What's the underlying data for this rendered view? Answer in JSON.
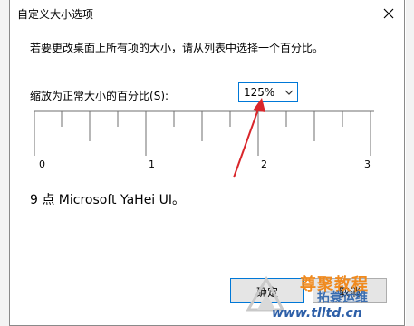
{
  "dialog": {
    "title": "自定义大小选项",
    "close_label": "×",
    "description": "若要更改桌面上所有项的大小，请从列表中选择一个百分比。",
    "scale_label_prefix": "缩放为正常大小的百分比(",
    "scale_label_key": "S",
    "scale_label_suffix": "):",
    "scale_value": "125%",
    "ruler_labels": [
      "0",
      "1",
      "2",
      "3"
    ],
    "font_info": "9 点 Microsoft YaHei UI。",
    "ok_label": "确定",
    "cancel_label": "取消"
  },
  "watermark": {
    "text_cn": "尊聚教程",
    "text_cn2": "拓蓑运维",
    "url": "www.tlltd.cn"
  },
  "colors": {
    "accent": "#0078d7",
    "arrow": "#d9262b",
    "watermark_orange": "#f08a1e",
    "watermark_blue": "#2d5fa8"
  }
}
